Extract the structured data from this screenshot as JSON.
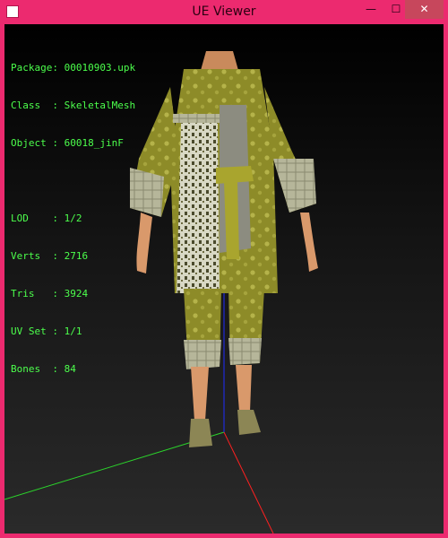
{
  "window": {
    "title": "UE Viewer",
    "controls": {
      "minimize": "—",
      "maximize": "☐",
      "close": "✕"
    },
    "icon": "app-icon"
  },
  "info": {
    "package_label": "Package",
    "package_value": "00010903.upk",
    "class_label": "Class",
    "class_value": "SkeletalMesh",
    "object_label": "Object",
    "object_value": "60018_jinF",
    "lod_label": "LOD",
    "lod_value": "1/2",
    "verts_label": "Verts",
    "verts_value": "2716",
    "tris_label": "Tris",
    "tris_value": "3924",
    "uvset_label": "UV Set",
    "uvset_value": "1/1",
    "bones_label": "Bones",
    "bones_value": "84"
  },
  "colors": {
    "frame": "#ec2a6f",
    "info_text": "#4cff4c",
    "axis_x": "#ff2020",
    "axis_y": "#2bd42b",
    "axis_z": "#1f2cff",
    "robe": "#8d8b28",
    "skin": "#d9996b"
  }
}
